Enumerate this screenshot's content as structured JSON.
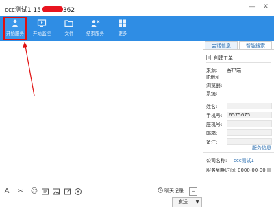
{
  "window": {
    "title_prefix": "ccc测试1 15",
    "title_suffix": "362",
    "minimize": "—",
    "close": "✕"
  },
  "toolbar": {
    "items": [
      {
        "label": "开始服务",
        "icon": "person-service-icon"
      },
      {
        "label": "开始监控",
        "icon": "monitor-icon"
      },
      {
        "label": "文件",
        "icon": "folder-icon"
      },
      {
        "label": "结束服务",
        "icon": "end-service-icon"
      },
      {
        "label": "更多",
        "icon": "grid-icon"
      }
    ]
  },
  "input_bar": {
    "font_glyph": "A",
    "scissors_glyph": "✂",
    "emoji_glyph": "☺",
    "history_label": "聊天记录"
  },
  "send": {
    "label": "发送",
    "dropdown": "▼"
  },
  "panel": {
    "tabs": [
      "会话信息",
      "智能搜索"
    ],
    "create_ticket": "创建工单",
    "session": [
      {
        "label": "来源:",
        "value": "客户端"
      },
      {
        "label": "IP地址:",
        "value": ""
      },
      {
        "label": "浏览器:",
        "value": ""
      },
      {
        "label": "系统:",
        "value": ""
      }
    ],
    "contact": [
      {
        "label": "姓名:",
        "value": ""
      },
      {
        "label": "手机号:",
        "value": "6575675"
      },
      {
        "label": "座机号:",
        "value": ""
      },
      {
        "label": "邮箱:",
        "value": ""
      },
      {
        "label": "备注:",
        "value": ""
      }
    ],
    "service_info_link": "服务信息",
    "company": {
      "label": "公司名称:",
      "value": "ccc测试1"
    },
    "expire": {
      "label": "服务到期时间:",
      "value": "0000-00-00"
    }
  },
  "colors": {
    "toolbar": "#2f8de4",
    "highlight": "#e01010",
    "link": "#2c6fb0"
  }
}
